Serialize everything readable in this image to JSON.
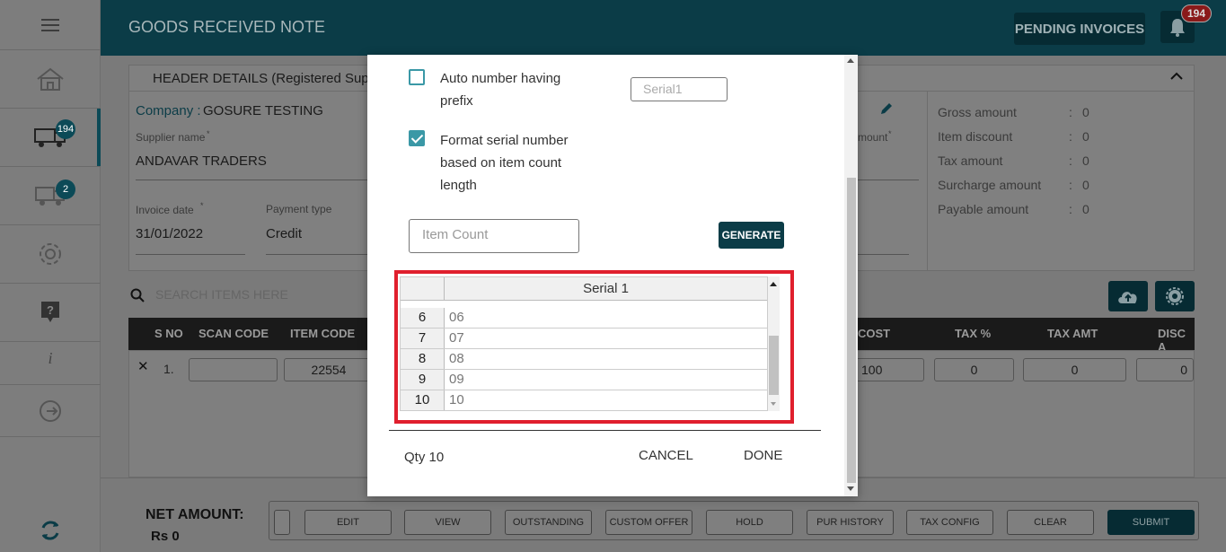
{
  "header": {
    "title": "GOODS RECEIVED NOTE",
    "pending_label": "PENDING INVOICES",
    "notif_count": "194"
  },
  "sidebar": {
    "truck_badge_1": "194",
    "truck_badge_2": "2"
  },
  "details": {
    "section_title": "HEADER DETAILS (Registered Suppl",
    "company_label": "Company :",
    "company_value": "GOSURE TESTING",
    "supplier_label": "Supplier name",
    "supplier_value": "ANDAVAR TRADERS",
    "invoice_date_label": "Invoice date",
    "invoice_date_value": "31/01/2022",
    "payment_type_label": "Payment type",
    "payment_type_value": "Credit",
    "amount_label": "mount",
    "asterisk": "*"
  },
  "totals": [
    {
      "label": "Gross amount",
      "value": "0"
    },
    {
      "label": "Item discount",
      "value": "0"
    },
    {
      "label": "Tax amount",
      "value": "0"
    },
    {
      "label": "Surcharge amount",
      "value": "0"
    },
    {
      "label": "Payable amount",
      "value": "0"
    }
  ],
  "totals_sep": ":",
  "search": {
    "placeholder": "SEARCH ITEMS HERE"
  },
  "grid": {
    "headers": {
      "sno": "S NO",
      "scan": "SCAN CODE",
      "item": "ITEM CODE",
      "cost": "COST",
      "tax": "TAX %",
      "taxamt": "TAX AMT",
      "disc": "DISC A"
    },
    "row": {
      "close": "✕",
      "sno": "1.",
      "item_code": "22554",
      "cost": "100",
      "tax": "0",
      "tax_amt": "0",
      "disc": "0"
    }
  },
  "footer": {
    "net_label": "NET AMOUNT:",
    "net_value": "Rs 0",
    "buttons": [
      "EDIT",
      "VIEW",
      "OUTSTANDING",
      "CUSTOM OFFER",
      "HOLD",
      "PUR HISTORY",
      "TAX CONFIG",
      "CLEAR",
      "SUBMIT"
    ]
  },
  "modal": {
    "auto_number_label_1": "Auto number having",
    "auto_number_label_2": "prefix",
    "auto_number_checked": false,
    "serial_prefix_placeholder": "Serial1",
    "format_label_1": "Format serial number",
    "format_label_2": "based on item count",
    "format_label_3": "length",
    "format_checked": true,
    "item_count_placeholder": "Item Count",
    "generate_label": "GENERATE",
    "table_header": "Serial 1",
    "rows": [
      {
        "n": "6",
        "v": "06"
      },
      {
        "n": "7",
        "v": "07"
      },
      {
        "n": "8",
        "v": "08"
      },
      {
        "n": "9",
        "v": "09"
      },
      {
        "n": "10",
        "v": "10"
      }
    ],
    "qty_label": "Qty 10",
    "cancel_label": "CANCEL",
    "done_label": "DONE"
  }
}
